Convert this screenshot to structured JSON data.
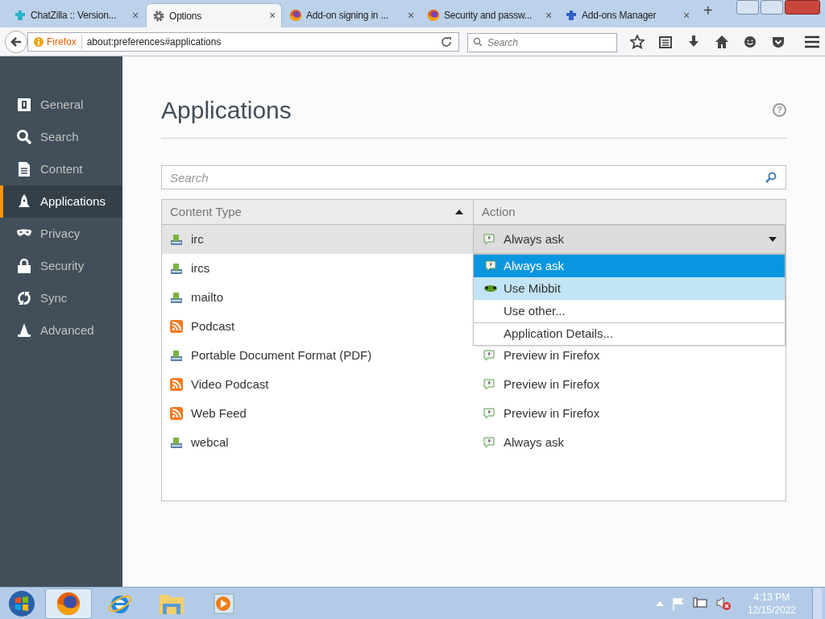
{
  "tabs": [
    {
      "title": "ChatZilla :: Version...",
      "close": "×",
      "selected": false
    },
    {
      "title": "Options",
      "close": "×",
      "selected": true
    },
    {
      "title": "Add-on signing in ...",
      "close": "×",
      "selected": false
    },
    {
      "title": "Security and passw...",
      "close": "×",
      "selected": false
    },
    {
      "title": "Add-ons Manager",
      "close": "×",
      "selected": false
    }
  ],
  "new_tab": "+",
  "nav_bar": {
    "identity": "Firefox",
    "url": "about:preferences#applications",
    "search_placeholder": "Search"
  },
  "sidebar": {
    "items": [
      {
        "label": "General",
        "selected": false
      },
      {
        "label": "Search",
        "selected": false
      },
      {
        "label": "Content",
        "selected": false
      },
      {
        "label": "Applications",
        "selected": true
      },
      {
        "label": "Privacy",
        "selected": false
      },
      {
        "label": "Security",
        "selected": false
      },
      {
        "label": "Sync",
        "selected": false
      },
      {
        "label": "Advanced",
        "selected": false
      }
    ]
  },
  "page": {
    "title": "Applications",
    "help": "?",
    "search_placeholder": "Search",
    "table": {
      "columns": [
        {
          "label": "Content Type",
          "sorted": true
        },
        {
          "label": "Action",
          "sorted": false
        }
      ],
      "rows": [
        {
          "type": "irc",
          "kind": "app",
          "selected": true,
          "action": "Always ask"
        },
        {
          "type": "ircs",
          "kind": "app",
          "selected": false
        },
        {
          "type": "mailto",
          "kind": "app",
          "selected": false
        },
        {
          "type": "Podcast",
          "kind": "feed",
          "selected": false
        },
        {
          "type": "Portable Document Format (PDF)",
          "kind": "app",
          "selected": false,
          "action": "Preview in Firefox"
        },
        {
          "type": "Video Podcast",
          "kind": "feed",
          "selected": false,
          "action": "Preview in Firefox"
        },
        {
          "type": "Web Feed",
          "kind": "feed",
          "selected": false,
          "action": "Preview in Firefox"
        },
        {
          "type": "webcal",
          "kind": "app",
          "selected": false,
          "action": "Always ask"
        }
      ]
    },
    "action_menu": {
      "items": [
        {
          "label": "Always ask",
          "kind": "ask",
          "selected": true,
          "hovered": false,
          "divider_before": false
        },
        {
          "label": "Use Mibbit",
          "kind": "app",
          "selected": false,
          "hovered": true,
          "divider_before": false
        },
        {
          "label": "Use other...",
          "kind": "plain",
          "selected": false,
          "hovered": false,
          "divider_before": false
        },
        {
          "label": "Application Details...",
          "kind": "plain",
          "selected": false,
          "hovered": false,
          "divider_before": true
        }
      ]
    }
  },
  "taskbar": {
    "items": [
      {
        "active": true
      },
      {
        "active": false
      },
      {
        "active": false
      },
      {
        "active": false
      }
    ],
    "time": "4:13 PM",
    "date": "12/15/2022"
  }
}
